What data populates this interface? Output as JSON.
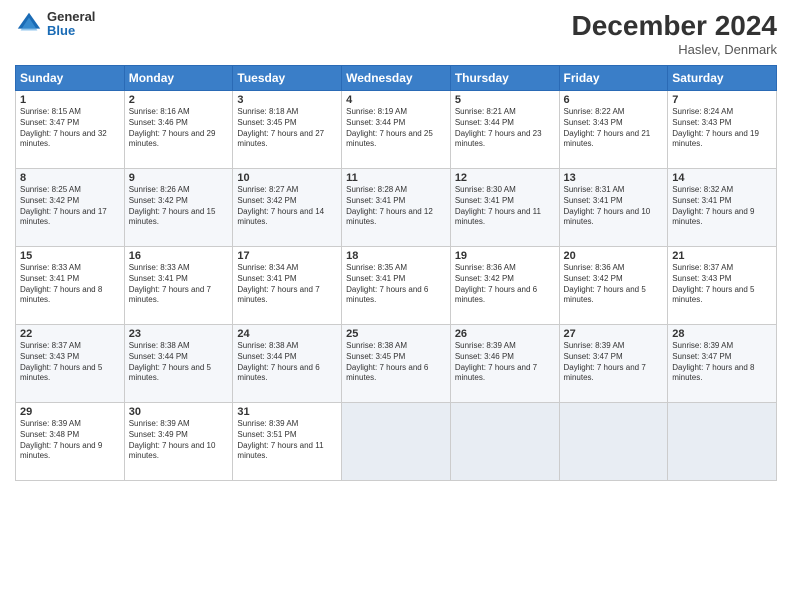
{
  "logo": {
    "general": "General",
    "blue": "Blue"
  },
  "header": {
    "title": "December 2024",
    "location": "Haslev, Denmark"
  },
  "days_of_week": [
    "Sunday",
    "Monday",
    "Tuesday",
    "Wednesday",
    "Thursday",
    "Friday",
    "Saturday"
  ],
  "weeks": [
    [
      {
        "day": "1",
        "sunrise": "8:15 AM",
        "sunset": "3:47 PM",
        "daylight": "7 hours and 32 minutes."
      },
      {
        "day": "2",
        "sunrise": "8:16 AM",
        "sunset": "3:46 PM",
        "daylight": "7 hours and 29 minutes."
      },
      {
        "day": "3",
        "sunrise": "8:18 AM",
        "sunset": "3:45 PM",
        "daylight": "7 hours and 27 minutes."
      },
      {
        "day": "4",
        "sunrise": "8:19 AM",
        "sunset": "3:44 PM",
        "daylight": "7 hours and 25 minutes."
      },
      {
        "day": "5",
        "sunrise": "8:21 AM",
        "sunset": "3:44 PM",
        "daylight": "7 hours and 23 minutes."
      },
      {
        "day": "6",
        "sunrise": "8:22 AM",
        "sunset": "3:43 PM",
        "daylight": "7 hours and 21 minutes."
      },
      {
        "day": "7",
        "sunrise": "8:24 AM",
        "sunset": "3:43 PM",
        "daylight": "7 hours and 19 minutes."
      }
    ],
    [
      {
        "day": "8",
        "sunrise": "8:25 AM",
        "sunset": "3:42 PM",
        "daylight": "7 hours and 17 minutes."
      },
      {
        "day": "9",
        "sunrise": "8:26 AM",
        "sunset": "3:42 PM",
        "daylight": "7 hours and 15 minutes."
      },
      {
        "day": "10",
        "sunrise": "8:27 AM",
        "sunset": "3:42 PM",
        "daylight": "7 hours and 14 minutes."
      },
      {
        "day": "11",
        "sunrise": "8:28 AM",
        "sunset": "3:41 PM",
        "daylight": "7 hours and 12 minutes."
      },
      {
        "day": "12",
        "sunrise": "8:30 AM",
        "sunset": "3:41 PM",
        "daylight": "7 hours and 11 minutes."
      },
      {
        "day": "13",
        "sunrise": "8:31 AM",
        "sunset": "3:41 PM",
        "daylight": "7 hours and 10 minutes."
      },
      {
        "day": "14",
        "sunrise": "8:32 AM",
        "sunset": "3:41 PM",
        "daylight": "7 hours and 9 minutes."
      }
    ],
    [
      {
        "day": "15",
        "sunrise": "8:33 AM",
        "sunset": "3:41 PM",
        "daylight": "7 hours and 8 minutes."
      },
      {
        "day": "16",
        "sunrise": "8:33 AM",
        "sunset": "3:41 PM",
        "daylight": "7 hours and 7 minutes."
      },
      {
        "day": "17",
        "sunrise": "8:34 AM",
        "sunset": "3:41 PM",
        "daylight": "7 hours and 7 minutes."
      },
      {
        "day": "18",
        "sunrise": "8:35 AM",
        "sunset": "3:41 PM",
        "daylight": "7 hours and 6 minutes."
      },
      {
        "day": "19",
        "sunrise": "8:36 AM",
        "sunset": "3:42 PM",
        "daylight": "7 hours and 6 minutes."
      },
      {
        "day": "20",
        "sunrise": "8:36 AM",
        "sunset": "3:42 PM",
        "daylight": "7 hours and 5 minutes."
      },
      {
        "day": "21",
        "sunrise": "8:37 AM",
        "sunset": "3:43 PM",
        "daylight": "7 hours and 5 minutes."
      }
    ],
    [
      {
        "day": "22",
        "sunrise": "8:37 AM",
        "sunset": "3:43 PM",
        "daylight": "7 hours and 5 minutes."
      },
      {
        "day": "23",
        "sunrise": "8:38 AM",
        "sunset": "3:44 PM",
        "daylight": "7 hours and 5 minutes."
      },
      {
        "day": "24",
        "sunrise": "8:38 AM",
        "sunset": "3:44 PM",
        "daylight": "7 hours and 6 minutes."
      },
      {
        "day": "25",
        "sunrise": "8:38 AM",
        "sunset": "3:45 PM",
        "daylight": "7 hours and 6 minutes."
      },
      {
        "day": "26",
        "sunrise": "8:39 AM",
        "sunset": "3:46 PM",
        "daylight": "7 hours and 7 minutes."
      },
      {
        "day": "27",
        "sunrise": "8:39 AM",
        "sunset": "3:47 PM",
        "daylight": "7 hours and 7 minutes."
      },
      {
        "day": "28",
        "sunrise": "8:39 AM",
        "sunset": "3:47 PM",
        "daylight": "7 hours and 8 minutes."
      }
    ],
    [
      {
        "day": "29",
        "sunrise": "8:39 AM",
        "sunset": "3:48 PM",
        "daylight": "7 hours and 9 minutes."
      },
      {
        "day": "30",
        "sunrise": "8:39 AM",
        "sunset": "3:49 PM",
        "daylight": "7 hours and 10 minutes."
      },
      {
        "day": "31",
        "sunrise": "8:39 AM",
        "sunset": "3:51 PM",
        "daylight": "7 hours and 11 minutes."
      },
      null,
      null,
      null,
      null
    ]
  ],
  "labels": {
    "sunrise": "Sunrise:",
    "sunset": "Sunset:",
    "daylight": "Daylight:"
  }
}
